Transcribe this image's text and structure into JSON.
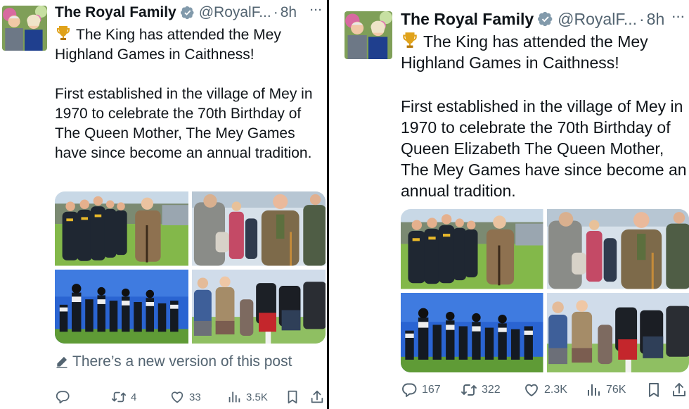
{
  "left": {
    "author_name": "The Royal Family",
    "handle": "@RoyalF...",
    "separator": "·",
    "time": "8h",
    "more": "···",
    "headline": "The King has attended the Mey Highland Games in Caithness!",
    "paragraph": "First established in the village of Mey in 1970 to celebrate the 70th Birthday of The Queen Mother, The Mey Games have since become an annual tradition.",
    "notice": "There’s a new version of this post",
    "reply_count": "",
    "retweet_count": "4",
    "like_count": "33",
    "view_count": "3.5K"
  },
  "right": {
    "author_name": "The Royal Family",
    "handle": "@RoyalF...",
    "separator": "·",
    "time": "8h",
    "more": "···",
    "headline": "The King has attended the Mey Highland Games in Caithness!",
    "paragraph": "First established in the village of Mey in 1970 to celebrate the 70th Birthday of Queen Elizabeth The Queen Mother, The Mey Games have since become an annual tradition.",
    "reply_count": "167",
    "retweet_count": "322",
    "like_count": "2.3K",
    "view_count": "76K"
  },
  "icons": {
    "verified": "verified-badge-icon",
    "trophy": "trophy-emoji",
    "edit": "pencil-icon",
    "reply": "reply-icon",
    "retweet": "retweet-icon",
    "like": "heart-icon",
    "views": "views-bar-chart-icon",
    "bookmark": "bookmark-icon",
    "share": "share-icon"
  },
  "colors": {
    "verified": "#829aab",
    "text": "#0f1419",
    "muted": "#536471"
  }
}
